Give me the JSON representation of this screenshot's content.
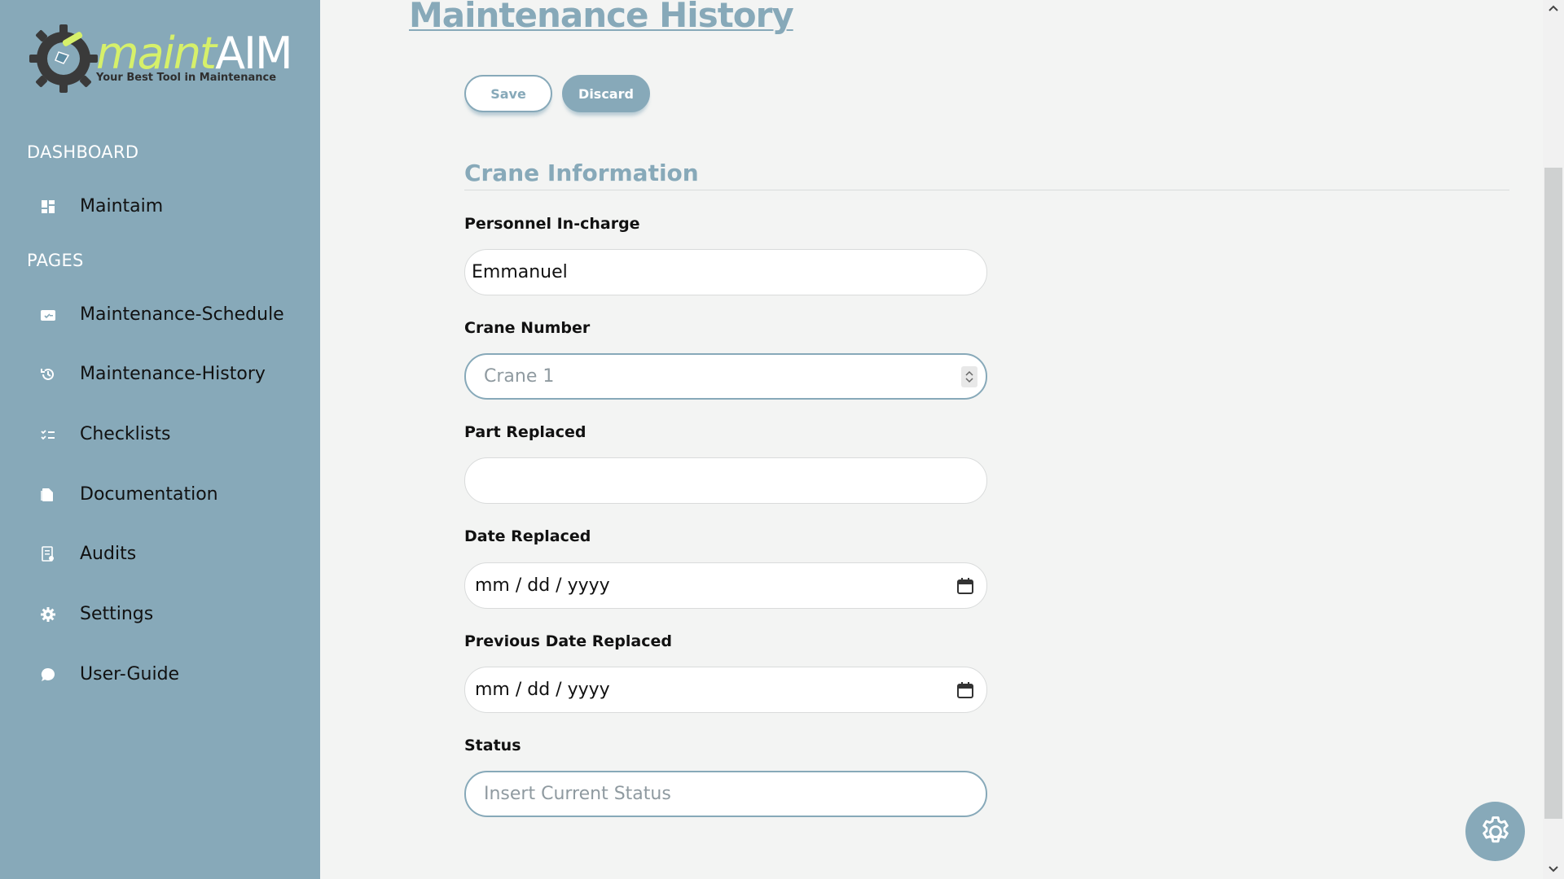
{
  "brand": {
    "word_part1": "maint",
    "word_part2": "AIM",
    "tagline": "Your Best Tool in Maintenance"
  },
  "sidebar": {
    "dashboard_heading": "DASHBOARD",
    "pages_heading": "PAGES",
    "items": [
      {
        "label": "Maintaim",
        "icon": "dashboard-grid-icon"
      },
      {
        "label": "Maintenance-Schedule",
        "icon": "calendar-check-icon"
      },
      {
        "label": "Maintenance-History",
        "icon": "history-icon"
      },
      {
        "label": "Checklists",
        "icon": "checklist-icon"
      },
      {
        "label": "Documentation",
        "icon": "documents-icon"
      },
      {
        "label": "Audits",
        "icon": "audit-report-icon"
      },
      {
        "label": "Settings",
        "icon": "gear-icon"
      },
      {
        "label": "User-Guide",
        "icon": "chat-bubble-icon"
      }
    ]
  },
  "main": {
    "title": "Maintenance History",
    "save_label": "Save",
    "discard_label": "Discard",
    "section_title": "Crane Information",
    "fields": {
      "personnel": {
        "label": "Personnel In-charge",
        "value": "Emmanuel"
      },
      "crane_number": {
        "label": "Crane Number",
        "placeholder": "Crane 1"
      },
      "part_replaced": {
        "label": "Part Replaced",
        "value": ""
      },
      "date_replaced": {
        "label": "Date Replaced",
        "value": "mm / dd / yyyy"
      },
      "previous_date": {
        "label": "Previous Date Replaced",
        "value": "mm / dd / yyyy"
      },
      "status": {
        "label": "Status",
        "placeholder": "Insert Current Status"
      }
    }
  },
  "colors": {
    "accent": "#87a9b9",
    "logo_green": "#d6f06a",
    "background": "#f3f4f3"
  }
}
